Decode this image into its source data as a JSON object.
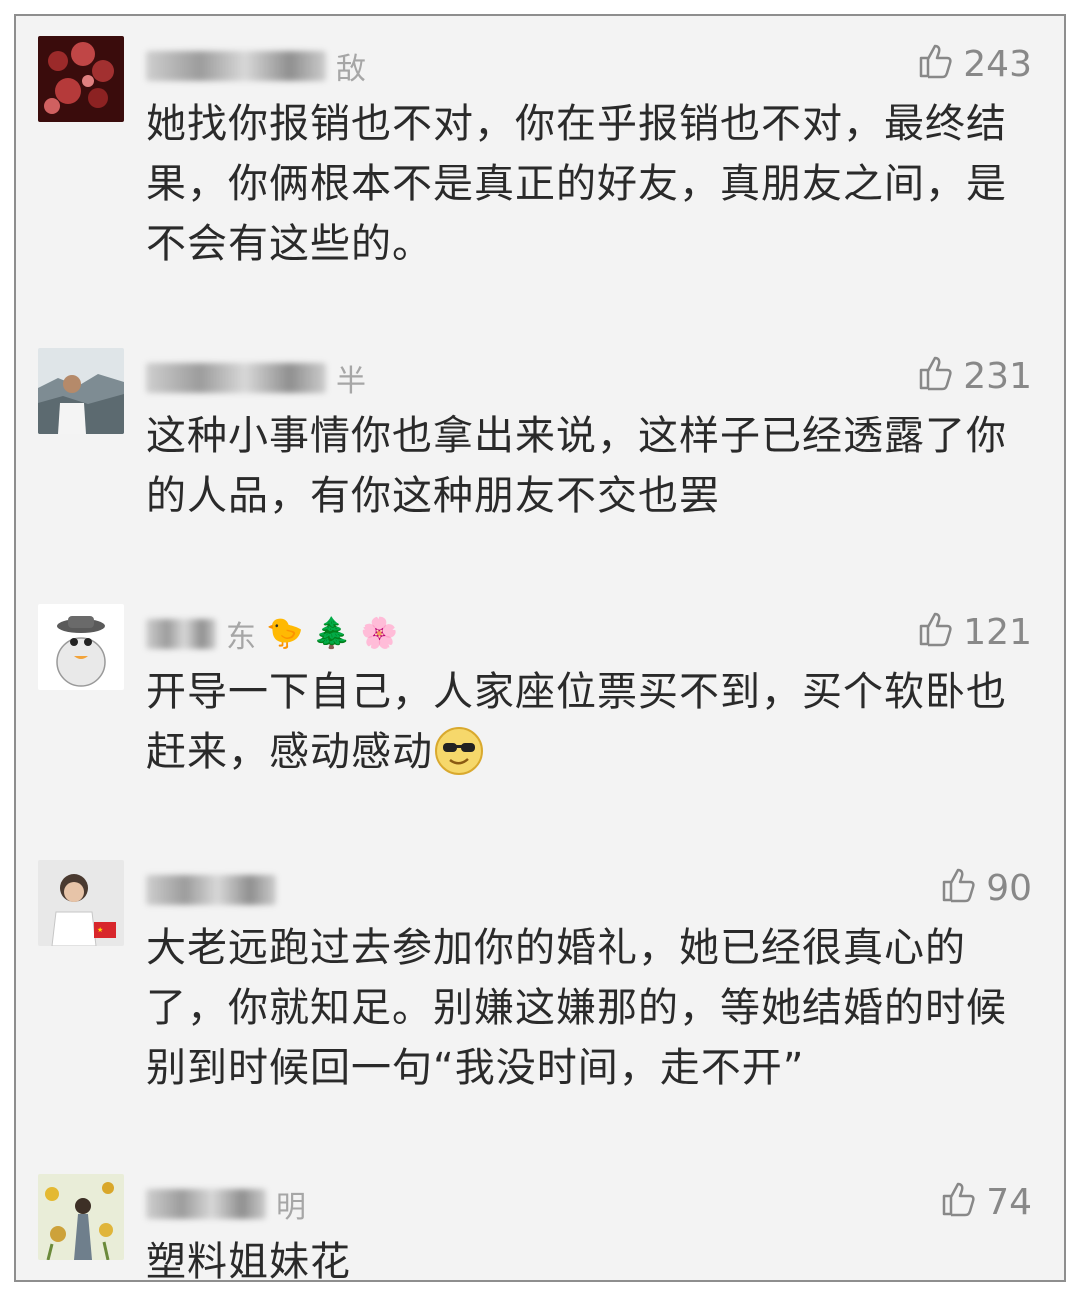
{
  "comments": [
    {
      "username_hint": "敌",
      "likes": "243",
      "text": "她找你报销也不对，你在乎报销也不对，最终结果，你俩根本不是真正的好友，真朋友之间，是不会有这些的。"
    },
    {
      "username_hint": "半",
      "likes": "231",
      "text": "这种小事情你也拿出来说，这样子已经透露了你的人品，有你这种朋友不交也罢"
    },
    {
      "username_hint": "东",
      "username_emojis": [
        "🐤",
        "🌲",
        "🌸"
      ],
      "likes": "121",
      "text": "开导一下自己，人家座位票买不到，买个软卧也赶来，感动感动"
    },
    {
      "username_hint": "",
      "likes": "90",
      "text": "大老远跑过去参加你的婚礼，她已经很真心的了，你就知足。别嫌这嫌那的，等她结婚的时候别到时候回一句“我没时间，走不开”"
    },
    {
      "username_hint": "明",
      "likes": "74",
      "text": "塑料姐妹花"
    }
  ],
  "icons": {
    "like": "thumbs-up-icon",
    "emoji_sunglasses": "sunglasses-emoji-icon"
  },
  "colors": {
    "background": "#f3f3f3",
    "text": "#2a2a2a",
    "likes": "#888888",
    "border": "#8e8e8e"
  }
}
